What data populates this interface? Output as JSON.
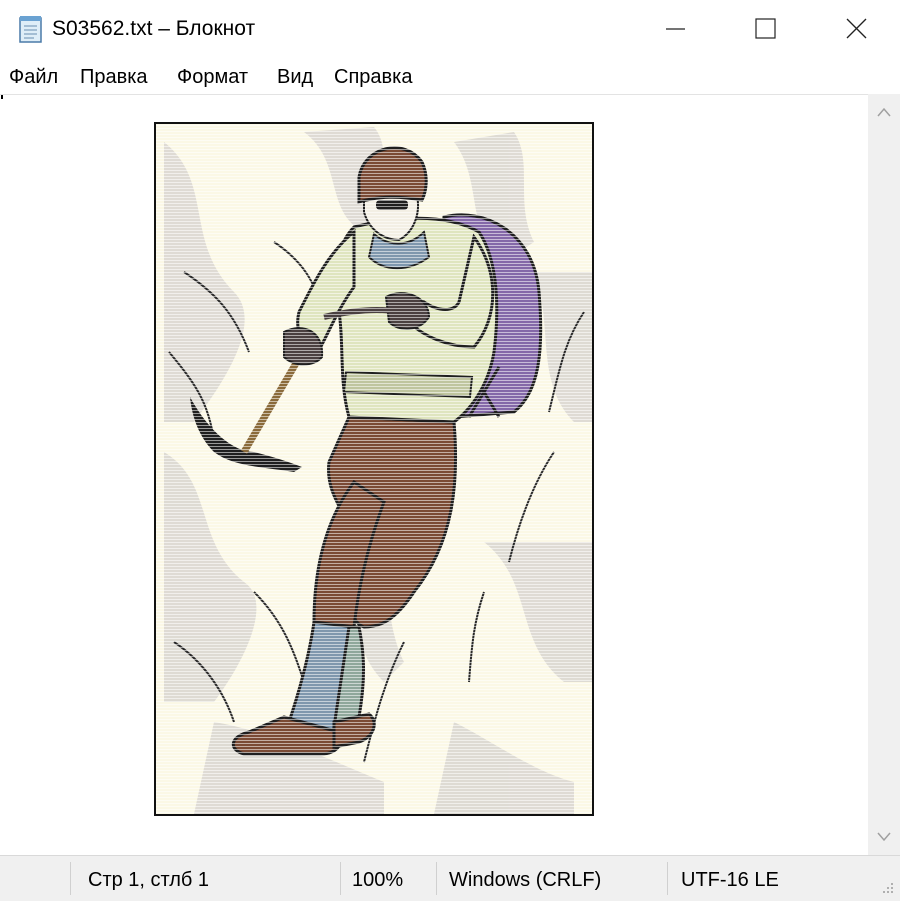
{
  "window": {
    "title": "S03562.txt – Блокнот",
    "icon": "notepad-icon",
    "controls": [
      "minimize-icon",
      "maximize-icon",
      "close-icon"
    ]
  },
  "menu": {
    "items": [
      "Файл",
      "Правка",
      "Формат",
      "Вид",
      "Справка"
    ]
  },
  "editor": {
    "content": "ascii-art-mountain-climber-image",
    "scrollbar": {
      "up_icon": "chevron-up-icon",
      "down_icon": "chevron-down-icon"
    }
  },
  "status": {
    "position": "Стр 1, стлб 1",
    "zoom": "100%",
    "line_endings": "Windows (CRLF)",
    "encoding": "UTF-16 LE"
  },
  "colors": {
    "snow": "#fbf8e6",
    "jacket": "#dfe5bf",
    "pants": "#7a4a34",
    "gaiters": "#7f97ad",
    "backpack": "#8468a8",
    "status_bg": "#f0f0f0"
  }
}
